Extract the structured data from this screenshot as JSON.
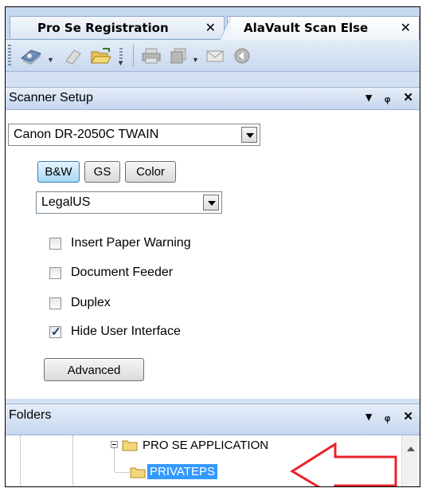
{
  "tabs": [
    {
      "label": "Pro Se Registration",
      "close": "✕"
    },
    {
      "label": "AlaVault Scan Else",
      "close": "✕"
    }
  ],
  "toolbar": {
    "icons": [
      "scan-icon",
      "eraser-icon",
      "open-folder-icon",
      "printer-icon",
      "copy-icon",
      "mail-icon",
      "back-icon"
    ]
  },
  "scanner_setup": {
    "title": "Scanner Setup",
    "controls": {
      "dropdown": "▾",
      "pin": "ᵩ",
      "close": "✕"
    },
    "scanner": "Canon DR-2050C TWAIN",
    "modes": [
      {
        "label": "B&W",
        "selected": true
      },
      {
        "label": "GS",
        "selected": false
      },
      {
        "label": "Color",
        "selected": false
      }
    ],
    "paper_size": "LegalUS",
    "options": [
      {
        "label": "Insert Paper Warning",
        "checked": false
      },
      {
        "label": "Document Feeder",
        "checked": false
      },
      {
        "label": "Duplex",
        "checked": false
      },
      {
        "label": "Hide User Interface",
        "checked": true
      }
    ],
    "check_mark": "✓",
    "advanced_label": "Advanced"
  },
  "folders": {
    "title": "Folders",
    "controls": {
      "dropdown": "▾",
      "pin": "ᵩ",
      "close": "✕"
    },
    "items": [
      {
        "label": "PRO SE APPLICATION"
      },
      {
        "label": "PRIVATEPS",
        "selected": true
      }
    ]
  },
  "colors": {
    "arrow": "#e8232a",
    "selection": "#3399ff",
    "pane_header": "#c5d6ee"
  }
}
